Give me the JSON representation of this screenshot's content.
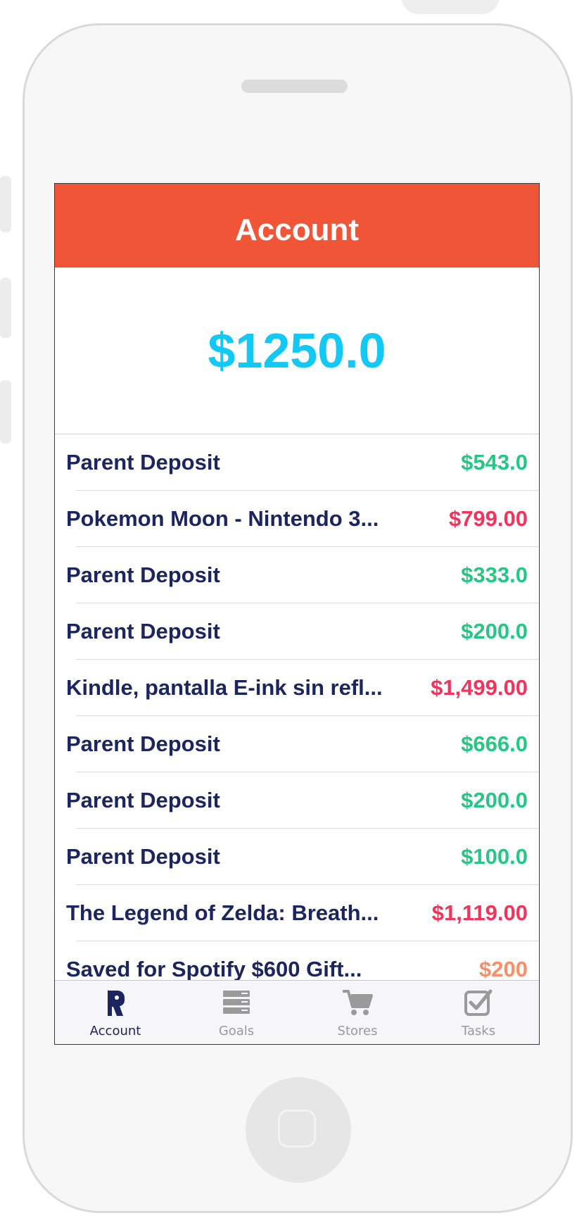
{
  "header": {
    "title": "Account"
  },
  "balance": {
    "amount": "$1250.0"
  },
  "transactions": [
    {
      "name": "Parent Deposit",
      "amount": "$543.0",
      "color": "#27c685"
    },
    {
      "name": "Pokemon Moon - Nintendo 3...",
      "amount": "$799.00",
      "color": "#f0345b"
    },
    {
      "name": "Parent Deposit",
      "amount": "$333.0",
      "color": "#27c685"
    },
    {
      "name": "Parent Deposit",
      "amount": "$200.0",
      "color": "#27c685"
    },
    {
      "name": "Kindle, pantalla E-ink sin refl...",
      "amount": "$1,499.00",
      "color": "#f0345b"
    },
    {
      "name": "Parent Deposit",
      "amount": "$666.0",
      "color": "#27c685"
    },
    {
      "name": "Parent Deposit",
      "amount": "$200.0",
      "color": "#27c685"
    },
    {
      "name": "Parent Deposit",
      "amount": "$100.0",
      "color": "#27c685"
    },
    {
      "name": "The Legend of Zelda: Breath...",
      "amount": "$1,119.00",
      "color": "#f0345b"
    },
    {
      "name": "Saved for Spotify $600 Gift...",
      "amount": "$200",
      "color": "#f5906a"
    }
  ],
  "tabs": [
    {
      "label": "Account",
      "icon": "account-icon",
      "active": true
    },
    {
      "label": "Goals",
      "icon": "goals-icon",
      "active": false
    },
    {
      "label": "Stores",
      "icon": "cart-icon",
      "active": false
    },
    {
      "label": "Tasks",
      "icon": "checkbox-icon",
      "active": false
    }
  ]
}
